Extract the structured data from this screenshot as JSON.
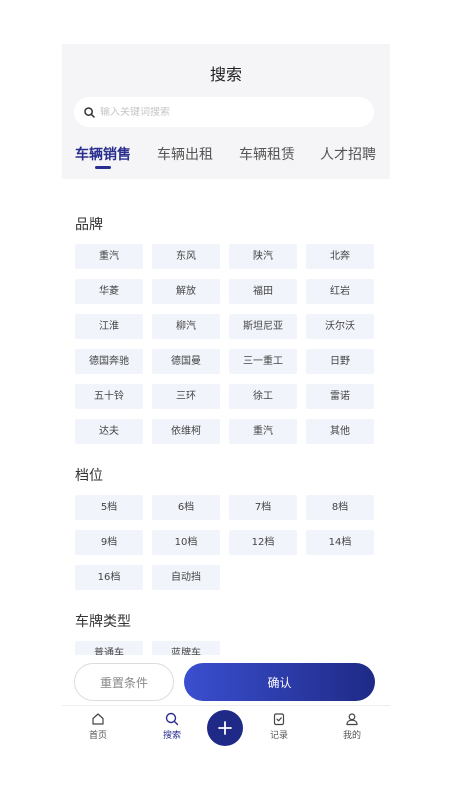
{
  "header": {
    "title": "搜索",
    "search_placeholder": "输入关键词搜索"
  },
  "tabs": [
    {
      "label": "车辆销售",
      "active": true
    },
    {
      "label": "车辆出租",
      "active": false
    },
    {
      "label": "车辆租赁",
      "active": false
    },
    {
      "label": "人才招聘",
      "active": false
    }
  ],
  "sections": {
    "brand": {
      "title": "品牌",
      "items": [
        "重汽",
        "东风",
        "陕汽",
        "北奔",
        "华菱",
        "解放",
        "福田",
        "红岩",
        "江淮",
        "柳汽",
        "斯坦尼亚",
        "沃尔沃",
        "德国奔驰",
        "德国曼",
        "三一重工",
        "日野",
        "五十铃",
        "三环",
        "徐工",
        "雷诺",
        "达夫",
        "依维柯",
        "重汽",
        "其他"
      ]
    },
    "gear": {
      "title": "档位",
      "items": [
        "5档",
        "6档",
        "7档",
        "8档",
        "9档",
        "10档",
        "12档",
        "14档",
        "16档",
        "自动挡"
      ]
    },
    "plate": {
      "title": "车牌类型",
      "items": [
        "普通车",
        "蓝牌车"
      ]
    }
  },
  "actions": {
    "reset_label": "重置条件",
    "confirm_label": "确认"
  },
  "bottom_nav": [
    {
      "label": "首页",
      "icon": "home-icon",
      "active": false
    },
    {
      "label": "搜索",
      "icon": "search-icon",
      "active": true
    },
    {
      "label": "记录",
      "icon": "record-icon",
      "active": false
    },
    {
      "label": "我的",
      "icon": "user-icon",
      "active": false
    }
  ],
  "fab_icon": "plus-icon",
  "colors": {
    "accent": "#2a2f8f",
    "chip_bg": "#f1f4fa",
    "header_bg": "#f5f5f7"
  }
}
